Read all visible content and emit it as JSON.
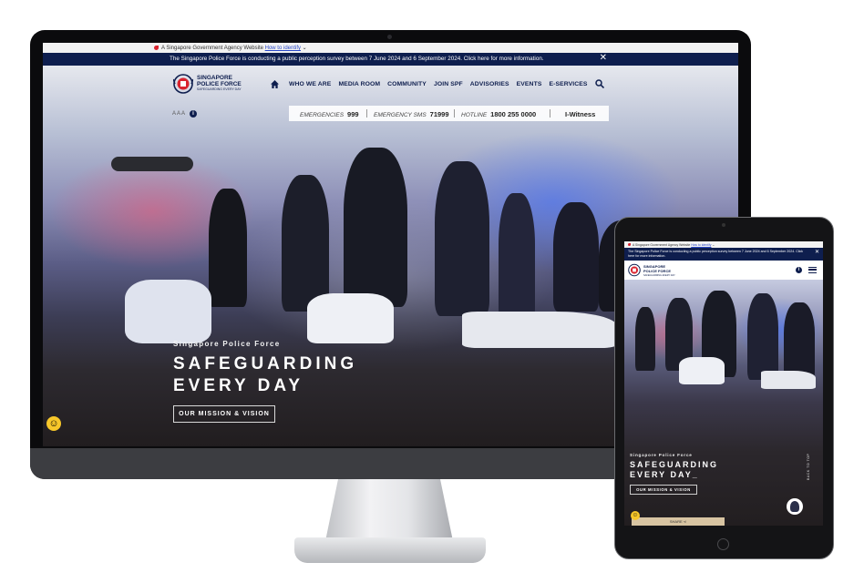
{
  "gov_bar": {
    "text": "A Singapore Government Agency Website",
    "link": "How to identify",
    "chevron": "⌄"
  },
  "survey_banner": {
    "text": "The Singapore Police Force is conducting a public perception survey between 7 June 2024 and 6 September 2024. Click here for more information.",
    "close": "✕"
  },
  "logo": {
    "line1": "SINGAPORE",
    "line2": "POLICE FORCE",
    "tagline": "SAFEGUARDING EVERY DAY"
  },
  "nav": {
    "items": [
      "WHO WE ARE",
      "MEDIA ROOM",
      "COMMUNITY",
      "JOIN SPF",
      "ADVISORIES",
      "EVENTS",
      "E-SERVICES"
    ]
  },
  "font_size": {
    "label": "A A A",
    "info": "i"
  },
  "utility": {
    "emergencies_label": "EMERGENCIES",
    "emergencies_number": "999",
    "sms_label": "EMERGENCY SMS",
    "sms_number": "71999",
    "hotline_label": "HOTLINE",
    "hotline_number": "1800 255 0000",
    "iwitness": "I-Witness"
  },
  "hero": {
    "kicker": "Singapore Police Force",
    "headline": "SAFEGUARDING\nEVERY DAY",
    "button": "OUR MISSION & VISION",
    "smiley": "☺"
  },
  "tablet": {
    "headline": "SAFEGUARDING\nEVERY DAY_",
    "share": "SHARE ⋖",
    "back_to_top": "BACK TO TOP"
  },
  "colors": {
    "navy": "#0e1e4e",
    "red": "#d9232e",
    "white": "#ffffff"
  }
}
